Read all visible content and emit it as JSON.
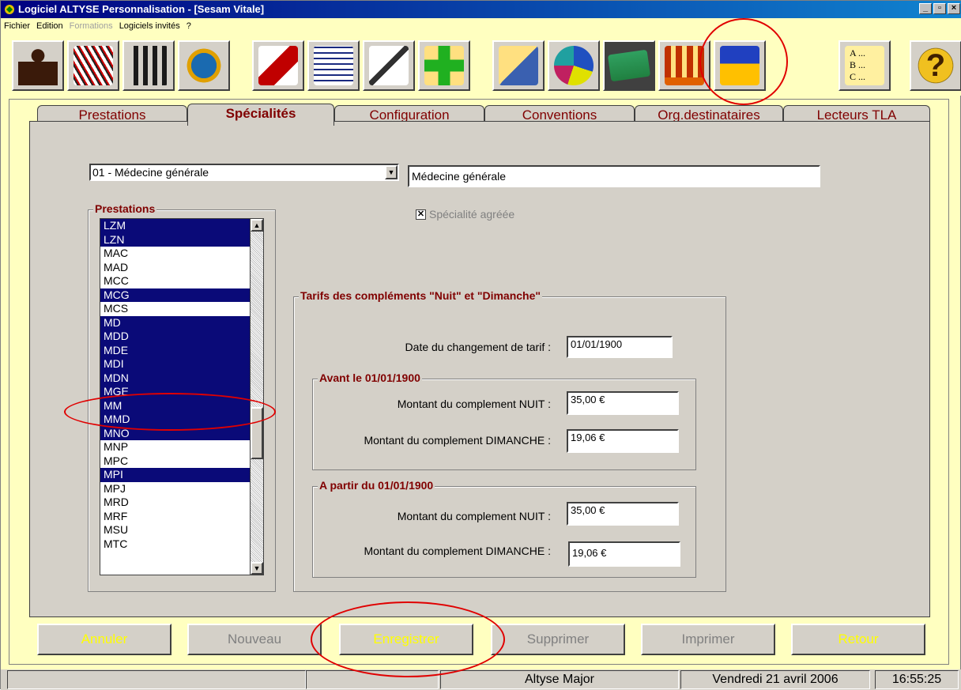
{
  "window": {
    "title": "Logiciel ALTYSE Personnalisation - [Sesam Vitale]",
    "controls": {
      "minimize": "_",
      "maximize": "▫",
      "close": "×"
    }
  },
  "menu": [
    "Fichier",
    "Edition",
    "Formations",
    "Logiciels invités",
    "?"
  ],
  "toolbar_icons": [
    "person-icon",
    "draw-tools-icon",
    "tools-icon",
    "refresh-icon",
    "flask-chart-icon",
    "documents-icon",
    "pen-write-icon",
    "cross-pen-icon",
    "pen-paper-icon",
    "eye-chart-icon",
    "card-icon",
    "stats-icon",
    "return-grid-icon",
    "abc-list-icon",
    "help-icon"
  ],
  "tabs": [
    {
      "label": "Prestations",
      "active": false
    },
    {
      "label": "Spécialités",
      "active": true
    },
    {
      "label": "Configuration",
      "active": false
    },
    {
      "label": "Conventions",
      "active": false
    },
    {
      "label": "Org.destinataires",
      "active": false
    },
    {
      "label": "Lecteurs TLA",
      "active": false
    }
  ],
  "specialite": {
    "select_value": "01 - Médecine générale",
    "name_value": "Médecine générale",
    "agreee_label": "Spécialité agréée",
    "agreee_checked": true
  },
  "prestations": {
    "title": "Prestations",
    "items": [
      {
        "code": "LZM",
        "selected": true
      },
      {
        "code": "LZN",
        "selected": true
      },
      {
        "code": "MAC",
        "selected": false
      },
      {
        "code": "MAD",
        "selected": false
      },
      {
        "code": "MCC",
        "selected": false
      },
      {
        "code": "MCG",
        "selected": true
      },
      {
        "code": "MCS",
        "selected": false
      },
      {
        "code": "MD",
        "selected": true
      },
      {
        "code": "MDD",
        "selected": true
      },
      {
        "code": "MDE",
        "selected": true
      },
      {
        "code": "MDI",
        "selected": true
      },
      {
        "code": "MDN",
        "selected": true
      },
      {
        "code": "MGE",
        "selected": true
      },
      {
        "code": "MM",
        "selected": true
      },
      {
        "code": "MMD",
        "selected": true
      },
      {
        "code": "MNO",
        "selected": true
      },
      {
        "code": "MNP",
        "selected": false
      },
      {
        "code": "MPC",
        "selected": false
      },
      {
        "code": "MPI",
        "selected": true
      },
      {
        "code": "MPJ",
        "selected": false
      },
      {
        "code": "MRD",
        "selected": false
      },
      {
        "code": "MRF",
        "selected": false
      },
      {
        "code": "MSU",
        "selected": false
      },
      {
        "code": "MTC",
        "selected": false
      }
    ]
  },
  "tarifs": {
    "title": "Tarifs des compléments \"Nuit\" et \"Dimanche\"",
    "date_label": "Date du changement de tarif :",
    "date_value": "01/01/1900",
    "avant": {
      "title": "Avant le 01/01/1900",
      "nuit_label": "Montant du complement  NUIT :",
      "nuit_value": "35,00 €",
      "dimanche_label": "Montant du complement  DIMANCHE :",
      "dimanche_value": "19,06 €"
    },
    "apres": {
      "title": "A partir du 01/01/1900",
      "nuit_label": "Montant du complement  NUIT :",
      "nuit_value": "35,00 €",
      "dimanche_label": "Montant du complement  DIMANCHE :",
      "dimanche_value": "19,06 €"
    }
  },
  "buttons": {
    "annuler": "Annuler",
    "nouveau": "Nouveau",
    "enregistrer": "Enregistrer",
    "supprimer": "Supprimer",
    "imprimer": "Imprimer",
    "retour": "Retour"
  },
  "status": {
    "user": "Altyse Major",
    "date": "Vendredi 21 avril 2006",
    "time": "16:55:25"
  },
  "colors": {
    "title_bar": "#000080",
    "tab_text": "#800000",
    "list_selection": "#0a0a78",
    "annotation_circle": "#e00000"
  }
}
